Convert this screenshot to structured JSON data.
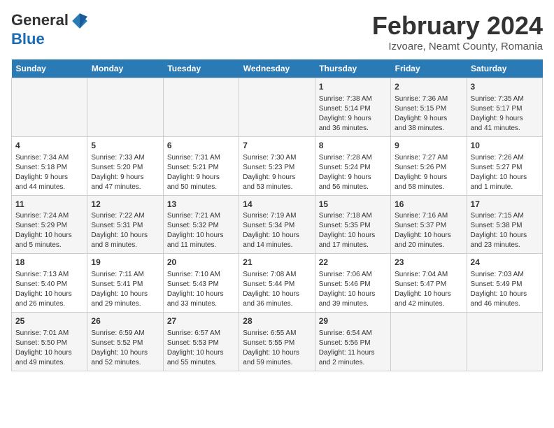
{
  "header": {
    "logo_general": "General",
    "logo_blue": "Blue",
    "month_title": "February 2024",
    "location": "Izvoare, Neamt County, Romania"
  },
  "weekdays": [
    "Sunday",
    "Monday",
    "Tuesday",
    "Wednesday",
    "Thursday",
    "Friday",
    "Saturday"
  ],
  "weeks": [
    [
      {
        "day": "",
        "info": ""
      },
      {
        "day": "",
        "info": ""
      },
      {
        "day": "",
        "info": ""
      },
      {
        "day": "",
        "info": ""
      },
      {
        "day": "1",
        "info": "Sunrise: 7:38 AM\nSunset: 5:14 PM\nDaylight: 9 hours\nand 36 minutes."
      },
      {
        "day": "2",
        "info": "Sunrise: 7:36 AM\nSunset: 5:15 PM\nDaylight: 9 hours\nand 38 minutes."
      },
      {
        "day": "3",
        "info": "Sunrise: 7:35 AM\nSunset: 5:17 PM\nDaylight: 9 hours\nand 41 minutes."
      }
    ],
    [
      {
        "day": "4",
        "info": "Sunrise: 7:34 AM\nSunset: 5:18 PM\nDaylight: 9 hours\nand 44 minutes."
      },
      {
        "day": "5",
        "info": "Sunrise: 7:33 AM\nSunset: 5:20 PM\nDaylight: 9 hours\nand 47 minutes."
      },
      {
        "day": "6",
        "info": "Sunrise: 7:31 AM\nSunset: 5:21 PM\nDaylight: 9 hours\nand 50 minutes."
      },
      {
        "day": "7",
        "info": "Sunrise: 7:30 AM\nSunset: 5:23 PM\nDaylight: 9 hours\nand 53 minutes."
      },
      {
        "day": "8",
        "info": "Sunrise: 7:28 AM\nSunset: 5:24 PM\nDaylight: 9 hours\nand 56 minutes."
      },
      {
        "day": "9",
        "info": "Sunrise: 7:27 AM\nSunset: 5:26 PM\nDaylight: 9 hours\nand 58 minutes."
      },
      {
        "day": "10",
        "info": "Sunrise: 7:26 AM\nSunset: 5:27 PM\nDaylight: 10 hours\nand 1 minute."
      }
    ],
    [
      {
        "day": "11",
        "info": "Sunrise: 7:24 AM\nSunset: 5:29 PM\nDaylight: 10 hours\nand 5 minutes."
      },
      {
        "day": "12",
        "info": "Sunrise: 7:22 AM\nSunset: 5:31 PM\nDaylight: 10 hours\nand 8 minutes."
      },
      {
        "day": "13",
        "info": "Sunrise: 7:21 AM\nSunset: 5:32 PM\nDaylight: 10 hours\nand 11 minutes."
      },
      {
        "day": "14",
        "info": "Sunrise: 7:19 AM\nSunset: 5:34 PM\nDaylight: 10 hours\nand 14 minutes."
      },
      {
        "day": "15",
        "info": "Sunrise: 7:18 AM\nSunset: 5:35 PM\nDaylight: 10 hours\nand 17 minutes."
      },
      {
        "day": "16",
        "info": "Sunrise: 7:16 AM\nSunset: 5:37 PM\nDaylight: 10 hours\nand 20 minutes."
      },
      {
        "day": "17",
        "info": "Sunrise: 7:15 AM\nSunset: 5:38 PM\nDaylight: 10 hours\nand 23 minutes."
      }
    ],
    [
      {
        "day": "18",
        "info": "Sunrise: 7:13 AM\nSunset: 5:40 PM\nDaylight: 10 hours\nand 26 minutes."
      },
      {
        "day": "19",
        "info": "Sunrise: 7:11 AM\nSunset: 5:41 PM\nDaylight: 10 hours\nand 29 minutes."
      },
      {
        "day": "20",
        "info": "Sunrise: 7:10 AM\nSunset: 5:43 PM\nDaylight: 10 hours\nand 33 minutes."
      },
      {
        "day": "21",
        "info": "Sunrise: 7:08 AM\nSunset: 5:44 PM\nDaylight: 10 hours\nand 36 minutes."
      },
      {
        "day": "22",
        "info": "Sunrise: 7:06 AM\nSunset: 5:46 PM\nDaylight: 10 hours\nand 39 minutes."
      },
      {
        "day": "23",
        "info": "Sunrise: 7:04 AM\nSunset: 5:47 PM\nDaylight: 10 hours\nand 42 minutes."
      },
      {
        "day": "24",
        "info": "Sunrise: 7:03 AM\nSunset: 5:49 PM\nDaylight: 10 hours\nand 46 minutes."
      }
    ],
    [
      {
        "day": "25",
        "info": "Sunrise: 7:01 AM\nSunset: 5:50 PM\nDaylight: 10 hours\nand 49 minutes."
      },
      {
        "day": "26",
        "info": "Sunrise: 6:59 AM\nSunset: 5:52 PM\nDaylight: 10 hours\nand 52 minutes."
      },
      {
        "day": "27",
        "info": "Sunrise: 6:57 AM\nSunset: 5:53 PM\nDaylight: 10 hours\nand 55 minutes."
      },
      {
        "day": "28",
        "info": "Sunrise: 6:55 AM\nSunset: 5:55 PM\nDaylight: 10 hours\nand 59 minutes."
      },
      {
        "day": "29",
        "info": "Sunrise: 6:54 AM\nSunset: 5:56 PM\nDaylight: 11 hours\nand 2 minutes."
      },
      {
        "day": "",
        "info": ""
      },
      {
        "day": "",
        "info": ""
      }
    ]
  ]
}
